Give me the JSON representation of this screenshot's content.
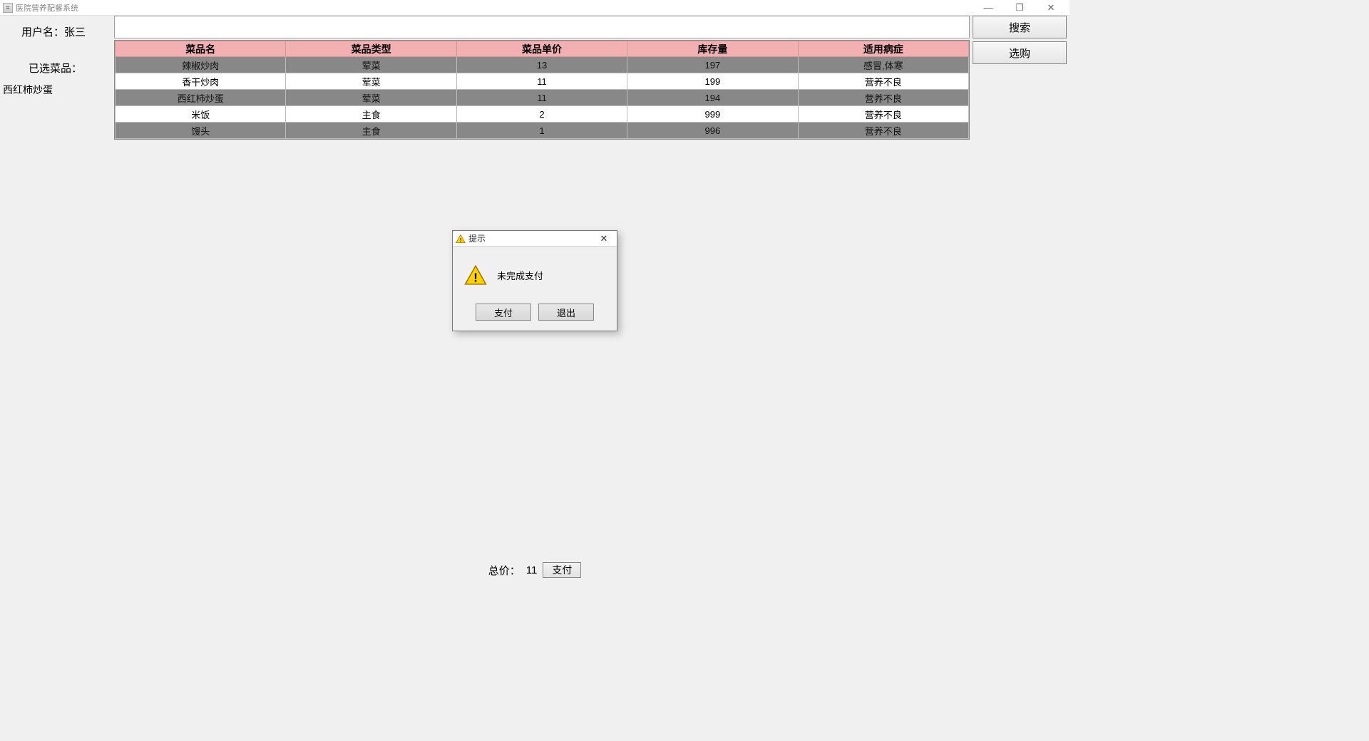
{
  "window": {
    "title": "医院营养配餐系统",
    "controls": {
      "minimize": "—",
      "maximize": "❐",
      "close": "✕"
    }
  },
  "sidebar": {
    "user_label": "用户名：",
    "user_name": "张三",
    "selected_label": "已选菜品：",
    "selected_items": [
      "西红柿炒蛋"
    ]
  },
  "search": {
    "value": ""
  },
  "buttons": {
    "search": "搜索",
    "select": "选购"
  },
  "table": {
    "headers": [
      "菜品名",
      "菜品类型",
      "菜品单价",
      "库存量",
      "适用病症"
    ],
    "rows": [
      [
        "辣椒炒肉",
        "荤菜",
        "13",
        "197",
        "感冒,体寒"
      ],
      [
        "香干炒肉",
        "荤菜",
        "11",
        "199",
        "营养不良"
      ],
      [
        "西红柿炒蛋",
        "荤菜",
        "11",
        "194",
        "营养不良"
      ],
      [
        "米饭",
        "主食",
        "2",
        "999",
        "营养不良"
      ],
      [
        "馒头",
        "主食",
        "1",
        "996",
        "营养不良"
      ]
    ]
  },
  "footer": {
    "total_label": "总价：",
    "total_value": "11",
    "pay_label": "支付"
  },
  "dialog": {
    "title": "提示",
    "message": "未完成支付",
    "pay": "支付",
    "exit": "退出"
  }
}
